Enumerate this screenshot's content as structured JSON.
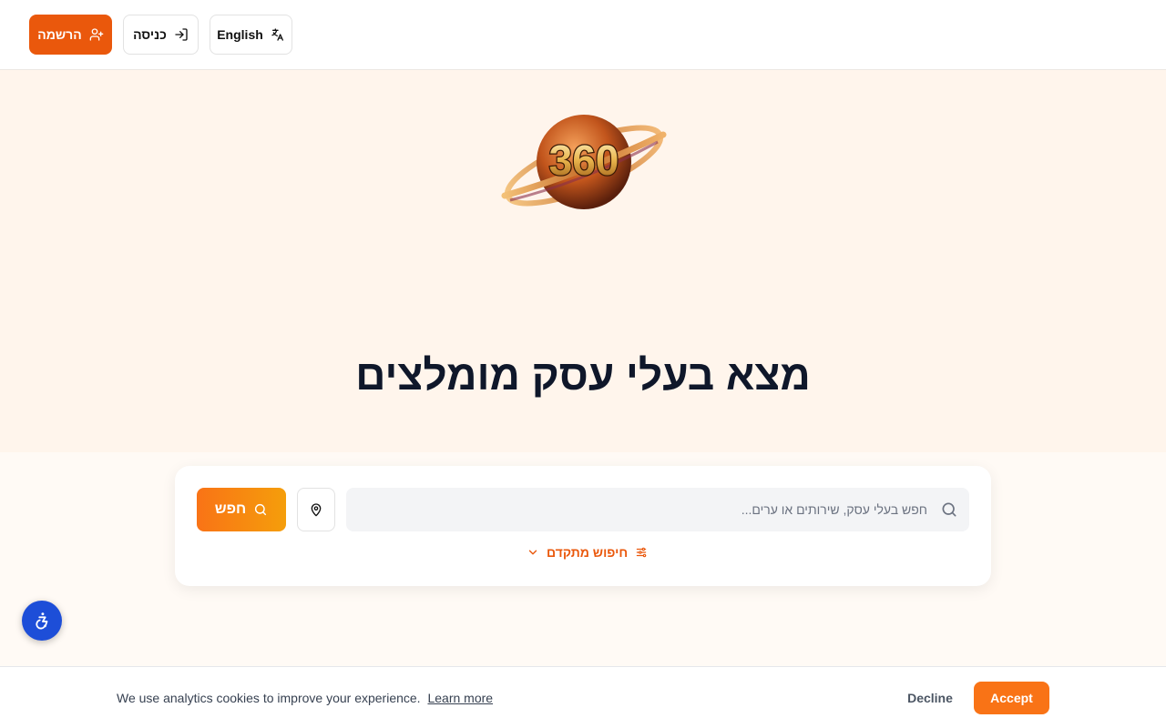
{
  "header": {
    "register_label": "הרשמה",
    "login_label": "כניסה",
    "language_label": "English"
  },
  "hero": {
    "logo_text": "360",
    "title": "מצא בעלי עסק מומלצים"
  },
  "search": {
    "placeholder": "חפש בעלי עסק, שירותים או ערים...",
    "value": "",
    "search_button_label": "חפש",
    "advanced_label": "חיפוש מתקדם"
  },
  "cookie_banner": {
    "message": "We use analytics cookies to improve your experience.",
    "learn_more": "Learn more",
    "decline_label": "Decline",
    "accept_label": "Accept"
  },
  "colors": {
    "accent": "#ea580c",
    "accent_light": "#f97316",
    "hero_bg": "#fff5ec",
    "accessibility": "#1d4ed8"
  },
  "icons": {
    "register": "user-plus-icon",
    "login": "log-in-icon",
    "language": "translate-icon",
    "search": "search-icon",
    "location": "map-pin-icon",
    "advanced": "sliders-icon",
    "chevron": "chevron-down-icon",
    "accessibility": "accessibility-icon"
  }
}
